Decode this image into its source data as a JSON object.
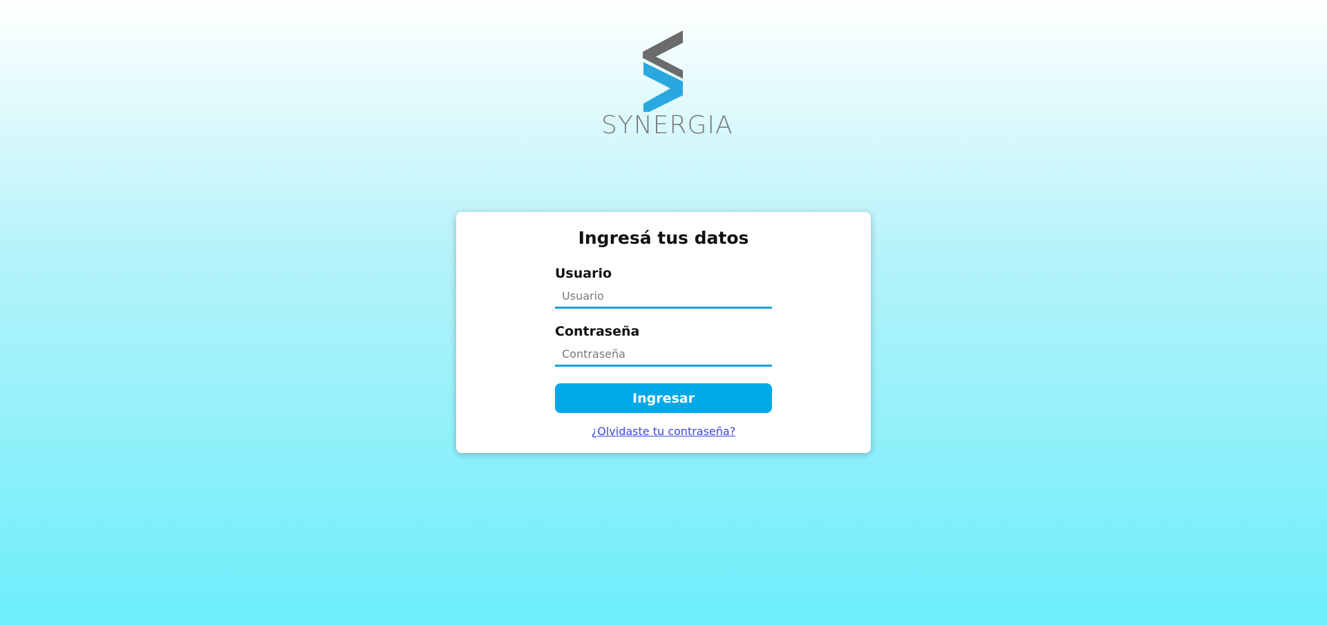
{
  "brand": {
    "name": "SYNERGIA",
    "colors": {
      "mark_top": "#6b6b6b",
      "mark_bottom": "#29a8e0",
      "text": "#757575"
    }
  },
  "login": {
    "title": "Ingresá tus datos",
    "username": {
      "label": "Usuario",
      "placeholder": "Usuario",
      "value": ""
    },
    "password": {
      "label": "Contraseña",
      "placeholder": "Contraseña",
      "value": ""
    },
    "submit_label": "Ingresar",
    "forgot_label": "¿Olvidaste tu contraseña?"
  },
  "theme": {
    "accent": "#00a8e8",
    "input_underline": "#1a9fd9",
    "link": "#3a44e0"
  }
}
